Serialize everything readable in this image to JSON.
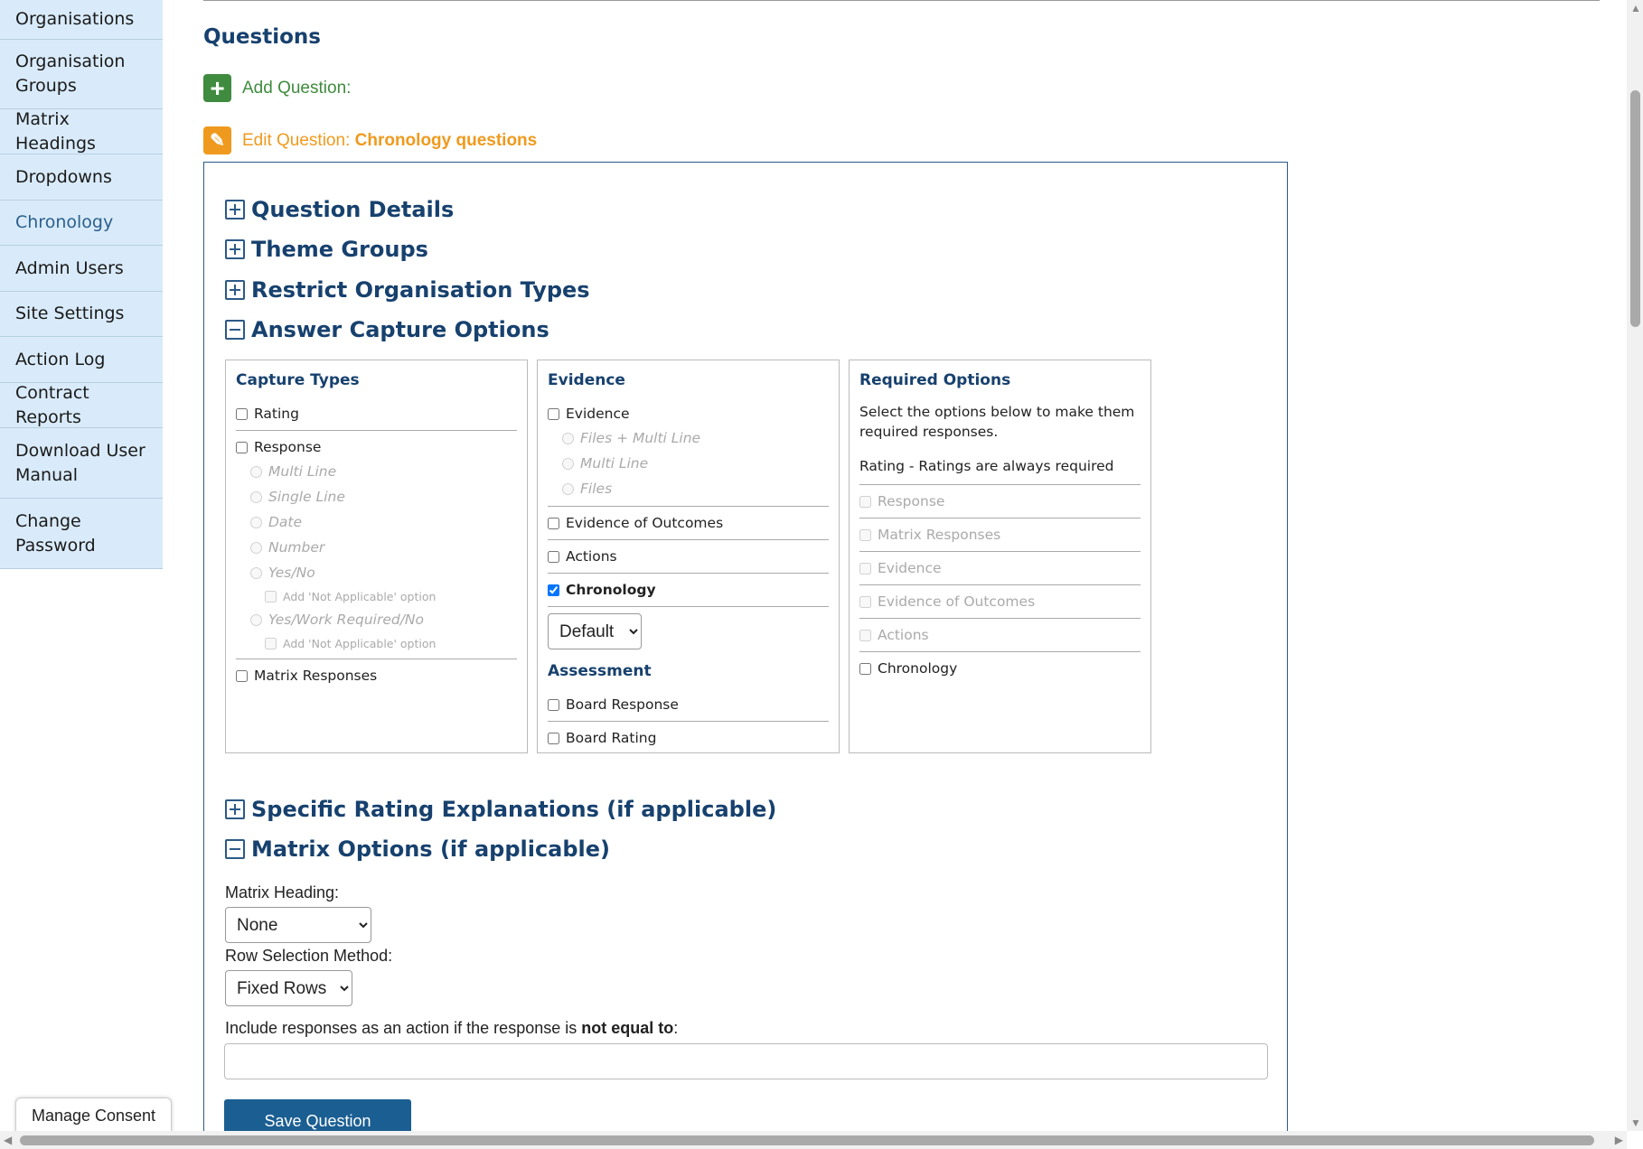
{
  "sidebar": {
    "items": [
      {
        "label": "Organisations"
      },
      {
        "label": "Organisation Groups"
      },
      {
        "label": "Matrix Headings"
      },
      {
        "label": "Dropdowns"
      },
      {
        "label": "Chronology"
      },
      {
        "label": "Admin Users"
      },
      {
        "label": "Site Settings"
      },
      {
        "label": "Action Log"
      },
      {
        "label": "Contract Reports"
      },
      {
        "label": "Download User Manual"
      },
      {
        "label": "Change Password"
      }
    ],
    "active": "Chronology"
  },
  "page": {
    "title": "Questions",
    "add_label": "Add Question:",
    "edit_label": "Edit Question:",
    "edit_name": "Chronology questions"
  },
  "sections": {
    "question_details": "Question Details",
    "theme_groups": "Theme Groups",
    "restrict_org_types": "Restrict Organisation Types",
    "answer_capture": "Answer Capture Options",
    "specific_rating": "Specific Rating Explanations (if applicable)",
    "matrix_options": "Matrix Options (if applicable)"
  },
  "capture_types": {
    "title": "Capture Types",
    "rating": "Rating",
    "response": "Response",
    "multi_line": "Multi Line",
    "single_line": "Single Line",
    "date": "Date",
    "number": "Number",
    "yes_no": "Yes/No",
    "add_na_1": "Add 'Not Applicable' option",
    "yes_work_no": "Yes/Work Required/No",
    "add_na_2": "Add 'Not Applicable' option",
    "matrix_responses": "Matrix Responses"
  },
  "evidence": {
    "title": "Evidence",
    "evidence": "Evidence",
    "files_multi": "Files + Multi Line",
    "multi_line": "Multi Line",
    "files": "Files",
    "evidence_outcomes": "Evidence of Outcomes",
    "actions": "Actions",
    "chronology": "Chronology",
    "chronology_checked": true,
    "default_select": "Default",
    "assessment_title": "Assessment",
    "board_response": "Board Response",
    "board_rating": "Board Rating"
  },
  "required": {
    "title": "Required Options",
    "description": "Select the options below to make them required responses.",
    "rating_note": "Rating - Ratings are always required",
    "response": "Response",
    "matrix_responses": "Matrix Responses",
    "evidence": "Evidence",
    "evidence_outcomes": "Evidence of Outcomes",
    "actions": "Actions",
    "chronology": "Chronology"
  },
  "matrix": {
    "heading_label": "Matrix Heading:",
    "heading_value": "None",
    "row_method_label": "Row Selection Method:",
    "row_method_value": "Fixed Rows",
    "include_prefix": "Include responses as an action if the response is ",
    "include_bold": "not equal to",
    "include_suffix": ":",
    "include_value": ""
  },
  "buttons": {
    "save": "Save Question",
    "consent": "Manage Consent"
  }
}
